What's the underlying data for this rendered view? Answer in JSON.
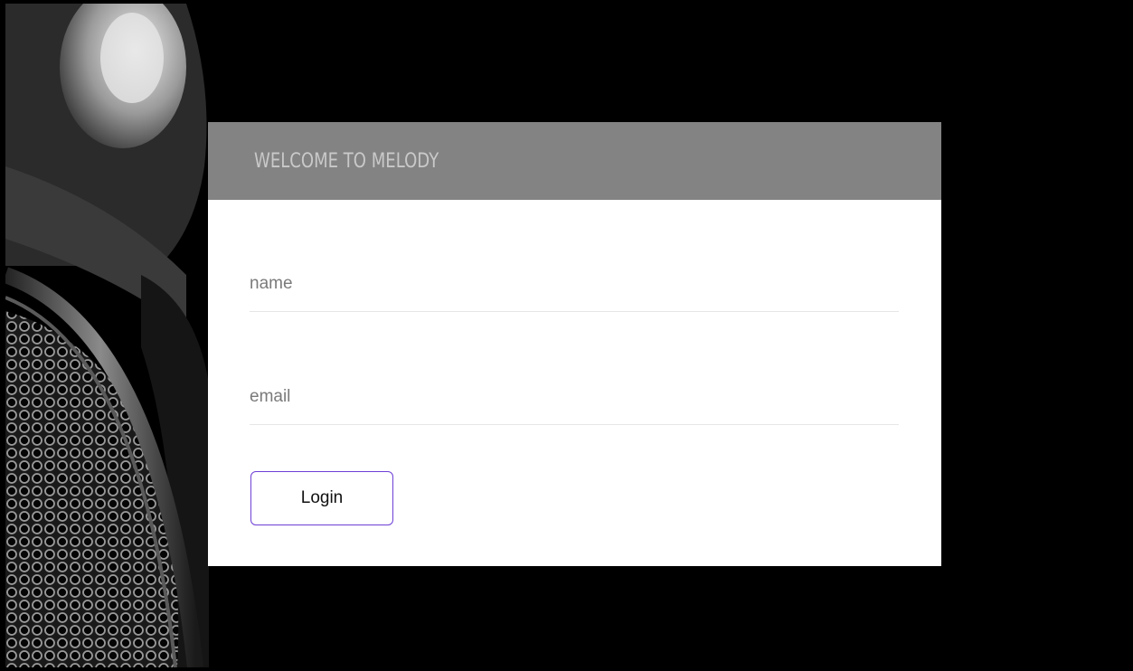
{
  "header": {
    "title": "WELCOME TO MELODY"
  },
  "form": {
    "name_placeholder": "name",
    "email_placeholder": "email",
    "login_label": "Login"
  },
  "colors": {
    "background": "#000000",
    "header_bar": "#838383",
    "header_text": "#c9c9c9",
    "card": "#ffffff",
    "button_border": "#6e3fd6"
  }
}
